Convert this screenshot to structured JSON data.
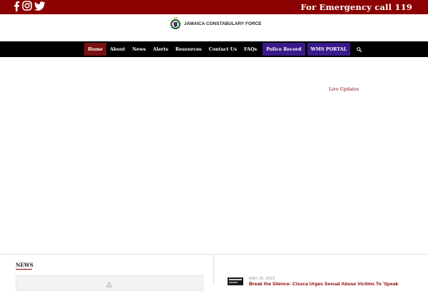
{
  "topbar": {
    "emergency_text": "For Emergency call 119",
    "social_icons": [
      "facebook-icon",
      "instagram-icon",
      "twitter-icon"
    ]
  },
  "brand": {
    "name": "JAMAICA CONSTABULARY FORCE"
  },
  "nav": {
    "items": [
      {
        "label": "Home"
      },
      {
        "label": "About"
      },
      {
        "label": "News"
      },
      {
        "label": "Alerts"
      },
      {
        "label": "Resources"
      },
      {
        "label": "Contact Us"
      },
      {
        "label": "FAQs"
      },
      {
        "label": "Police Record"
      },
      {
        "label": "WMS PORTAL"
      }
    ],
    "search_icon": "search-icon"
  },
  "live_updates": "Live Updates",
  "news": {
    "heading": "NEWS",
    "post": {
      "date": "MAY 25, 2023",
      "title": "Break the Silence: Cissca Urges Sexual Abuse Victims To 'Speak"
    }
  },
  "colors": {
    "brand_red": "#8b0000",
    "nav_black": "#000000",
    "active_red": "#7a0f0f",
    "portal_purple": "#3a1a8a"
  }
}
